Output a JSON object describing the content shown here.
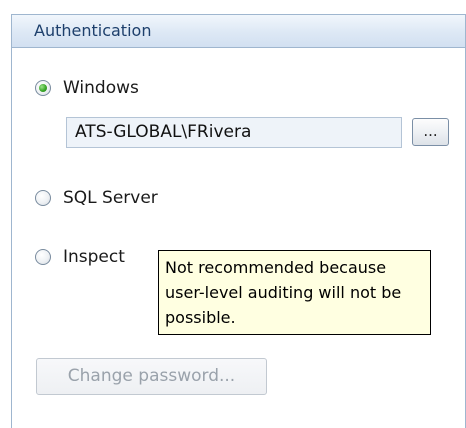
{
  "section": {
    "title": "Authentication"
  },
  "auth_options": [
    {
      "label": "Windows",
      "selected": true
    },
    {
      "label": "SQL Server",
      "selected": false
    },
    {
      "label": "Inspect",
      "selected": false
    }
  ],
  "windows_user": {
    "value": "ATS-GLOBAL\\FRivera",
    "browse_label": "..."
  },
  "tooltip": {
    "line1": "Not recommended because",
    "line2": "user-level auditing will not be",
    "line3": "possible."
  },
  "change_password": {
    "label": "Change password...",
    "enabled": false
  },
  "colors": {
    "header_text": "#1d3f6c",
    "radio_selected": "#3aa829",
    "tooltip_bg": "#ffffe1",
    "disabled_text": "#9aa2ab"
  },
  "icons": {
    "radio_checked": "radio-selected-icon",
    "radio_unchecked": "radio-unselected-icon"
  }
}
